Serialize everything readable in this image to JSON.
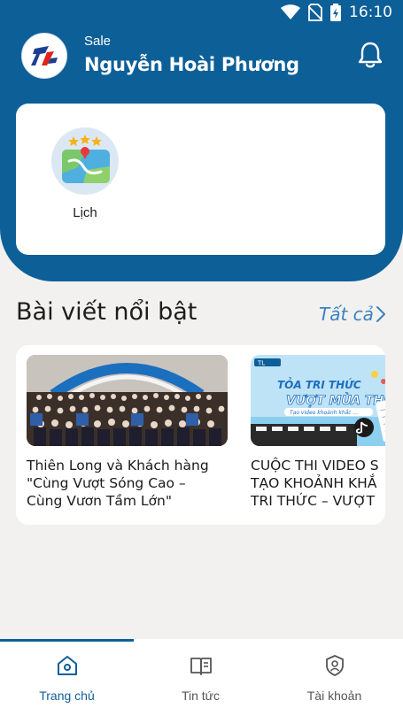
{
  "status_bar": {
    "time": "16:10"
  },
  "header": {
    "role": "Sale",
    "user_name": "Nguyễn Hoài Phương"
  },
  "features": [
    {
      "label": "Lịch",
      "icon": "calendar-map-icon"
    }
  ],
  "featured": {
    "title": "Bài viết nổi bật",
    "see_all": "Tất cả",
    "articles": [
      {
        "title": "Thiên Long và Khách hàng\n\"Cùng Vượt Sóng Cao –\nCùng Vươn Tầm Lớn\""
      },
      {
        "title": "CUỘC THI VIDEO S\nTẠO KHOẢNH KHẮ\nTRI THỨC – VƯỢT",
        "image_text": {
          "line1": "TỎA TRI THỨC",
          "line2": "VƯỢT MÙA THI",
          "line3": "Tạo video khoảnh khắc ...",
          "badge": "TL"
        }
      }
    ]
  },
  "tabs": [
    {
      "label": "Trang chủ",
      "icon": "home-icon",
      "active": true
    },
    {
      "label": "Tin tức",
      "icon": "book-icon",
      "active": false
    },
    {
      "label": "Tài khoản",
      "icon": "account-shield-icon",
      "active": false
    }
  ],
  "colors": {
    "primary": "#0d5f98",
    "accent": "#3a82c0",
    "background": "#f2f1ef"
  }
}
